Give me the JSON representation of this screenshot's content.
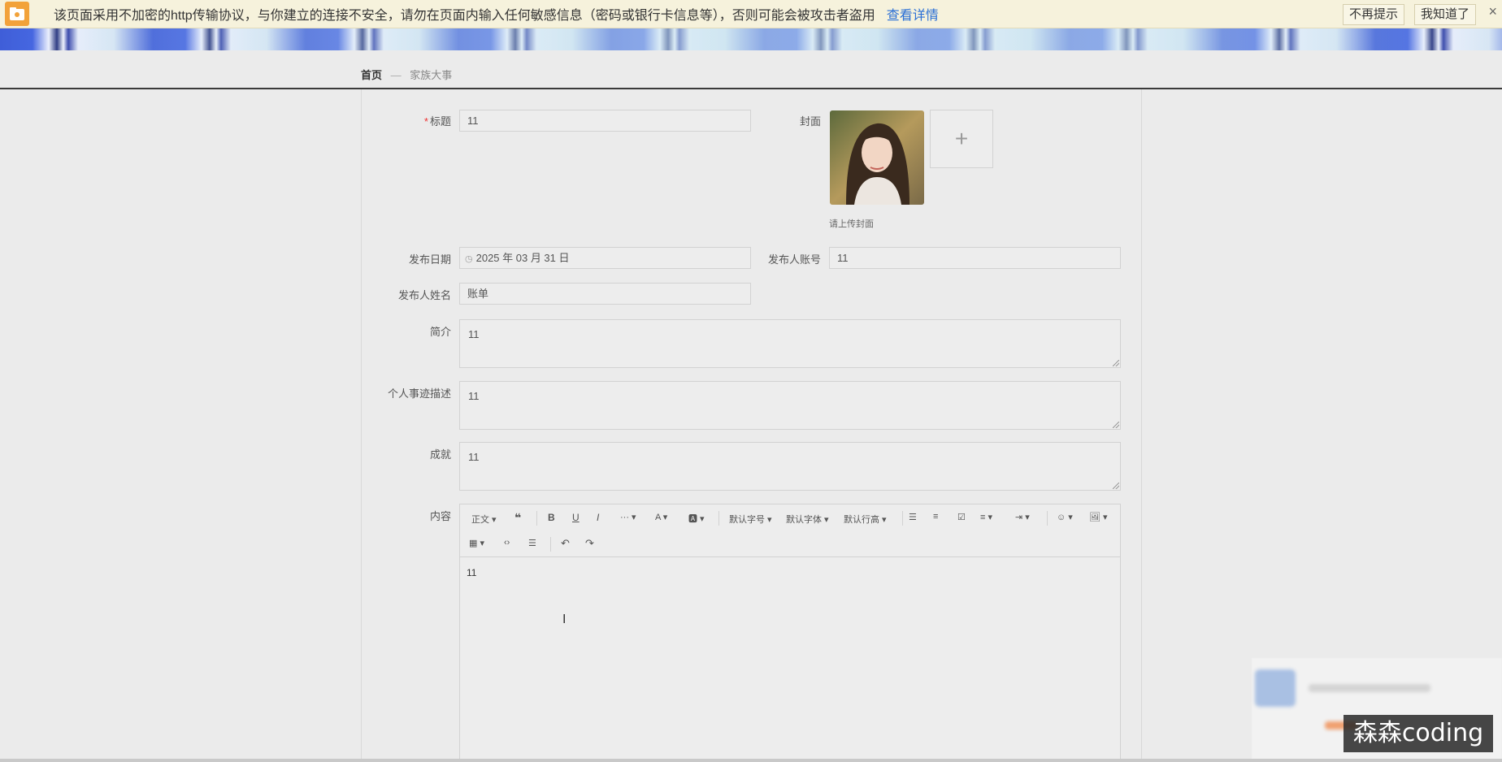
{
  "warning_bar": {
    "message": "该页面采用不加密的http传输协议，与你建立的连接不安全，请勿在页面内输入任何敏感信息（密码或银行卡信息等），否则可能会被攻击者盗用",
    "details_link": "查看详情",
    "dont_remind": "不再提示",
    "got_it": "我知道了",
    "close": "×"
  },
  "breadcrumb": {
    "home": "首页",
    "separator": "—",
    "current": "家族大事"
  },
  "form": {
    "title": {
      "label": "标题",
      "required_mark": "*",
      "value": "11"
    },
    "cover": {
      "label": "封面",
      "hint": "请上传封面",
      "add": "+"
    },
    "publish_date": {
      "label": "发布日期",
      "value": "2025 年 03 月 31 日"
    },
    "publisher_account": {
      "label": "发布人账号",
      "value": "11"
    },
    "publisher_name": {
      "label": "发布人姓名",
      "value": "账单"
    },
    "summary": {
      "label": "简介",
      "value": "11"
    },
    "deeds": {
      "label": "个人事迹描述",
      "value": "11"
    },
    "achievements": {
      "label": "成就",
      "value": "11"
    },
    "content": {
      "label": "内容",
      "toolbar": {
        "paragraph": "正文",
        "font_size": "默认字号",
        "font_family": "默认字体",
        "line_height": "默认行高"
      },
      "body": "11"
    }
  },
  "watermark": "森森coding"
}
